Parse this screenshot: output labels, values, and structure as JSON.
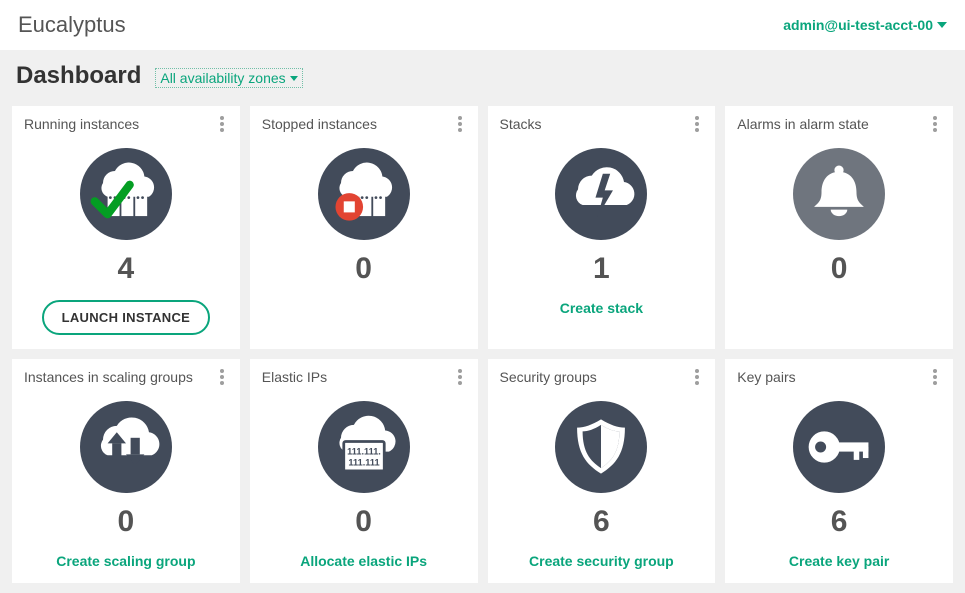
{
  "brand": "Eucalyptus",
  "user": {
    "label": "admin@ui-test-acct-00"
  },
  "header": {
    "title": "Dashboard",
    "zone_filter": "All availability zones"
  },
  "colors": {
    "accent": "#0aa57c",
    "circle": "#424b5a",
    "ok": "#049e23",
    "stop": "#e24432",
    "text": "#555555"
  },
  "tiles": [
    {
      "title": "Running instances",
      "count": "4",
      "button": "LAUNCH INSTANCE"
    },
    {
      "title": "Stopped instances",
      "count": "0"
    },
    {
      "title": "Stacks",
      "count": "1",
      "action": "Create stack"
    },
    {
      "title": "Alarms in alarm state",
      "count": "0"
    },
    {
      "title": "Instances in scaling groups",
      "count": "0",
      "action": "Create scaling group"
    },
    {
      "title": "Elastic IPs",
      "count": "0",
      "action": "Allocate elastic IPs"
    },
    {
      "title": "Security groups",
      "count": "6",
      "action": "Create security group"
    },
    {
      "title": "Key pairs",
      "count": "6",
      "action": "Create key pair"
    }
  ]
}
